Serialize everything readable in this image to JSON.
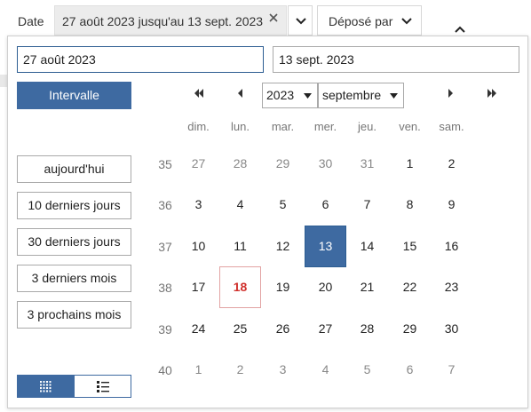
{
  "filter_bar": {
    "date_label": "Date",
    "date_value": "27 août 2023 jusqu'au 13 sept. 2023",
    "deposited_by_label": "Déposé par"
  },
  "range": {
    "start_value": "27 août 2023",
    "end_value": "13 sept. 2023"
  },
  "interval_button": "Intervalle",
  "presets": [
    "aujourd'hui",
    "10 derniers jours",
    "30 derniers jours",
    "3 derniers mois",
    "3 prochains mois"
  ],
  "calendar": {
    "year": "2023",
    "month": "septembre",
    "weekdays": [
      "dim.",
      "lun.",
      "mar.",
      "mer.",
      "jeu.",
      "ven.",
      "sam."
    ],
    "weeks": [
      {
        "num": "35",
        "days": [
          {
            "d": "27",
            "muted": true
          },
          {
            "d": "28",
            "muted": true
          },
          {
            "d": "29",
            "muted": true
          },
          {
            "d": "30",
            "muted": true
          },
          {
            "d": "31",
            "muted": true
          },
          {
            "d": "1"
          },
          {
            "d": "2"
          }
        ]
      },
      {
        "num": "36",
        "days": [
          {
            "d": "3"
          },
          {
            "d": "4"
          },
          {
            "d": "5"
          },
          {
            "d": "6"
          },
          {
            "d": "7"
          },
          {
            "d": "8"
          },
          {
            "d": "9"
          }
        ]
      },
      {
        "num": "37",
        "days": [
          {
            "d": "10"
          },
          {
            "d": "11"
          },
          {
            "d": "12"
          },
          {
            "d": "13",
            "selected": true
          },
          {
            "d": "14"
          },
          {
            "d": "15"
          },
          {
            "d": "16"
          }
        ]
      },
      {
        "num": "38",
        "days": [
          {
            "d": "17"
          },
          {
            "d": "18",
            "today": true
          },
          {
            "d": "19"
          },
          {
            "d": "20"
          },
          {
            "d": "21"
          },
          {
            "d": "22"
          },
          {
            "d": "23"
          }
        ]
      },
      {
        "num": "39",
        "days": [
          {
            "d": "24"
          },
          {
            "d": "25"
          },
          {
            "d": "26"
          },
          {
            "d": "27"
          },
          {
            "d": "28"
          },
          {
            "d": "29"
          },
          {
            "d": "30"
          }
        ]
      },
      {
        "num": "40",
        "days": [
          {
            "d": "1",
            "muted": true
          },
          {
            "d": "2",
            "muted": true
          },
          {
            "d": "3",
            "muted": true
          },
          {
            "d": "4",
            "muted": true
          },
          {
            "d": "5",
            "muted": true
          },
          {
            "d": "6",
            "muted": true
          },
          {
            "d": "7",
            "muted": true
          }
        ]
      }
    ]
  },
  "colors": {
    "accent": "#3e6aa1",
    "today": "#d0312d"
  },
  "icons": {
    "clear": "close-icon",
    "prev_year": "double-chevron-left-icon",
    "prev_month": "chevron-left-icon",
    "next_month": "chevron-right-icon",
    "next_year": "double-chevron-right-icon",
    "grid_view": "grid-view-icon",
    "list_view": "list-view-icon"
  }
}
